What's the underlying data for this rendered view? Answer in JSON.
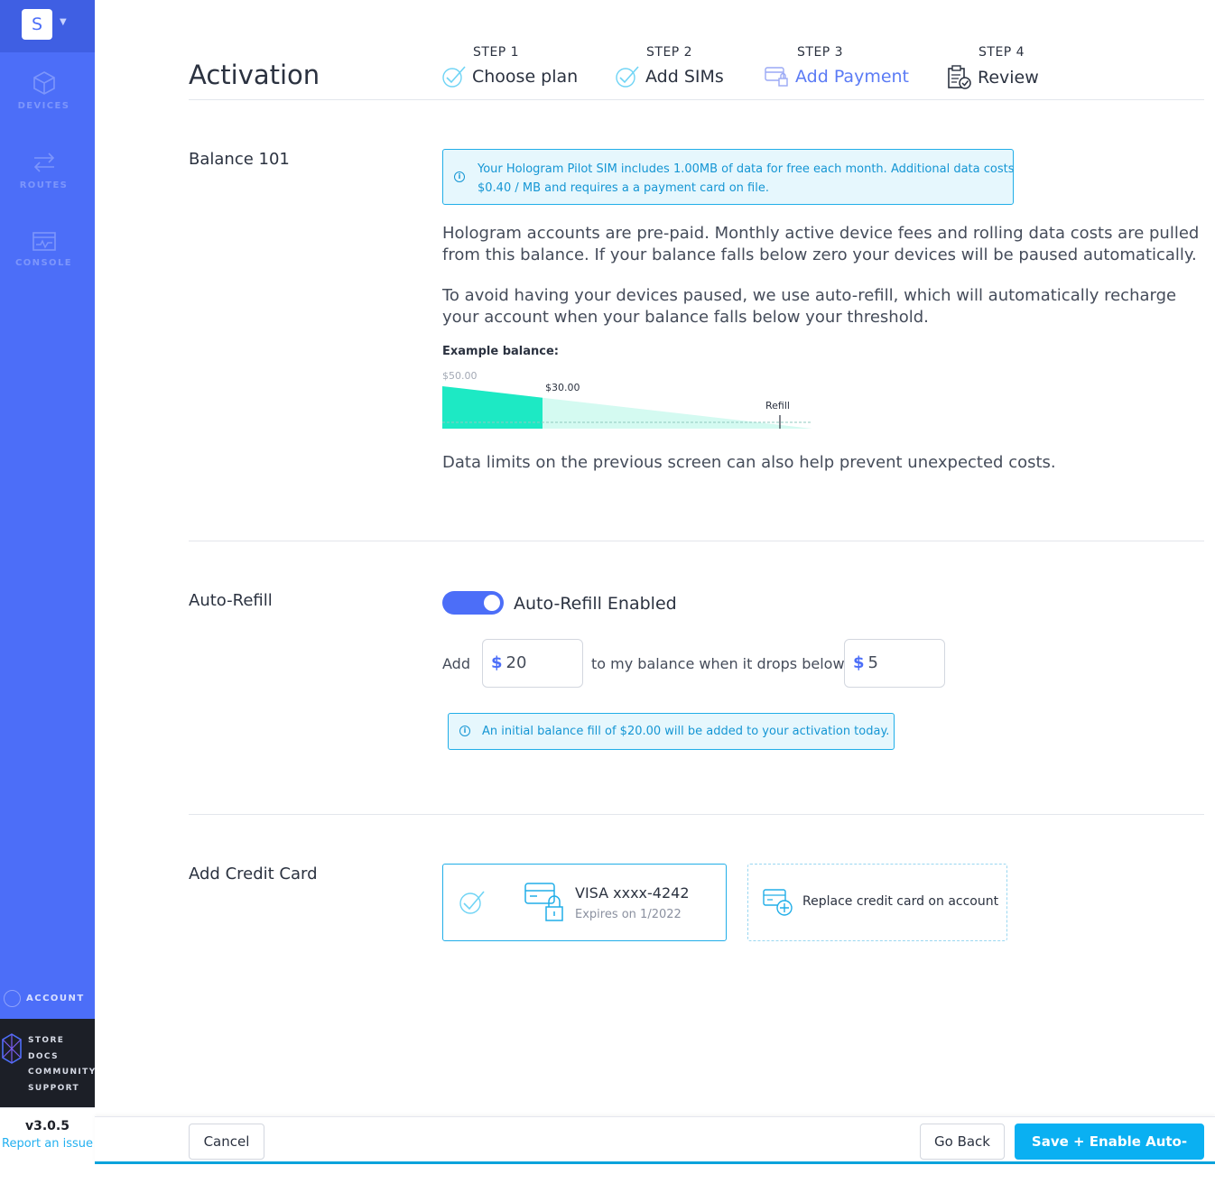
{
  "sidebar": {
    "org_initial": "S",
    "nav": [
      {
        "label": "DEVICES",
        "icon": "cube-icon"
      },
      {
        "label": "ROUTES",
        "icon": "arrows-exchange-icon"
      },
      {
        "label": "CONSOLE",
        "icon": "console-chart-icon"
      }
    ],
    "account_label": "ACCOUNT",
    "footer_links": [
      "STORE",
      "DOCS",
      "COMMUNITY",
      "SUPPORT"
    ],
    "version": "v3.0.5",
    "report_link": "Report an issue"
  },
  "page": {
    "title": "Activation"
  },
  "steps": [
    {
      "num": "STEP 1",
      "label": "Choose plan",
      "state": "done",
      "icon": "check-icon"
    },
    {
      "num": "STEP 2",
      "label": "Add SIMs",
      "state": "done",
      "icon": "check-icon"
    },
    {
      "num": "STEP 3",
      "label": "Add Payment",
      "state": "active",
      "icon": "payment-card-icon"
    },
    {
      "num": "STEP 4",
      "label": "Review",
      "state": "upcoming",
      "icon": "clipboard-check-icon"
    }
  ],
  "balance101": {
    "label": "Balance 101",
    "info_line1": "Your Hologram Pilot SIM includes 1.00MB of data for free each month. Additional data costs",
    "info_line2": "$0.40 / MB and requires a a payment card on file.",
    "para1": "Hologram accounts are pre-paid. Monthly active device fees and rolling data costs are pulled from this balance. If your balance falls below zero your devices will be paused automatically.",
    "para2": "To avoid having your devices paused, we use auto-refill, which will automatically recharge your account when your balance falls below your threshold.",
    "example_label": "Example balance:",
    "example_max": "$50.00",
    "example_current": "$30.00",
    "example_refill": "Refill",
    "para3": "Data limits on the previous screen can also help prevent unexpected costs."
  },
  "autorefill": {
    "label": "Auto-Refill",
    "toggle_label": "Auto-Refill Enabled",
    "toggle_on": true,
    "add_text": "Add",
    "currency": "$",
    "amount": "20",
    "middle_text": "to my balance when it drops below",
    "threshold": "5",
    "info": "An initial balance fill of $20.00 will be added to your activation today."
  },
  "credit_card": {
    "label": "Add Credit Card",
    "card_title": "VISA xxxx-4242",
    "card_expiry": "Expires on 1/2022",
    "replace_label": "Replace credit card on account"
  },
  "buttons": {
    "cancel": "Cancel",
    "go_back": "Go Back",
    "save": "Save + Enable Auto-Refill"
  },
  "colors": {
    "sidebar": "#4c6ef8",
    "accent": "#0ab0f2",
    "chart_fill": "#1de9c4"
  }
}
